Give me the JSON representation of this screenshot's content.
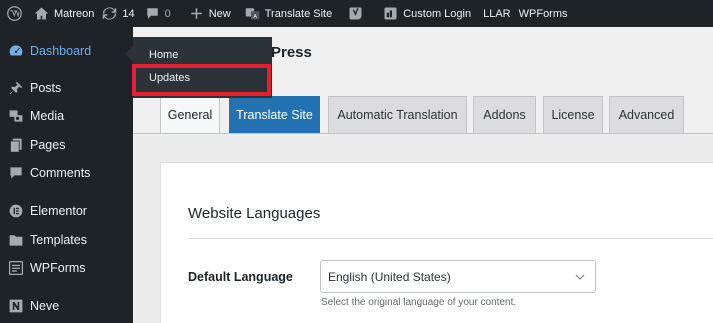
{
  "adminbar": {
    "site_name": "Matreon",
    "updates_count": "14",
    "comments_count": "0",
    "new_label": "New",
    "translate_site_label": "Translate Site",
    "custom_login_label": "Custom Login",
    "llar_label": "LLAR",
    "wpforms_label": "WPForms",
    "icons": [
      "wordpress-logo-icon",
      "home-icon",
      "updates-refresh-icon",
      "comment-bubble-icon",
      "plus-icon",
      "translate-icon",
      "yoast-icon",
      "custom-login-icon"
    ]
  },
  "sidebar": {
    "items": [
      {
        "label": "Dashboard",
        "icon": "dashboard-gauge-icon",
        "current": true
      },
      {
        "label": "Posts",
        "icon": "pushpin-icon"
      },
      {
        "label": "Media",
        "icon": "media-icon"
      },
      {
        "label": "Pages",
        "icon": "pages-icon"
      },
      {
        "label": "Comments",
        "icon": "comment-icon"
      },
      {
        "label": "Elementor",
        "icon": "elementor-icon"
      },
      {
        "label": "Templates",
        "icon": "folder-icon"
      },
      {
        "label": "WPForms",
        "icon": "wpforms-icon"
      },
      {
        "label": "Neve",
        "icon": "neve-icon"
      }
    ]
  },
  "flyout": {
    "items": [
      {
        "label": "Home"
      },
      {
        "label": "Updates"
      }
    ]
  },
  "page": {
    "title_partial": "Press",
    "tabs": [
      {
        "label": "General"
      },
      {
        "label": "Translate Site"
      },
      {
        "label": "Automatic Translation"
      },
      {
        "label": "Addons"
      },
      {
        "label": "License"
      },
      {
        "label": "Advanced"
      }
    ]
  },
  "settings": {
    "section_title": "Website Languages",
    "default_language_label": "Default Language",
    "default_language_value": "English (United States)",
    "default_language_help": "Select the original language of your content."
  },
  "colors": {
    "adminbar_bg": "#1d2327",
    "accent": "#2271b1",
    "current_menu": "#72aee6",
    "highlight": "#e3202c"
  }
}
